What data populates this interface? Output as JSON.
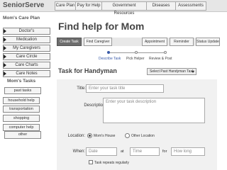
{
  "brand": "SeniorServe",
  "topnav": [
    "Care Plan",
    "Pay for Help",
    "Government Resources",
    "Diseases",
    "Assessments"
  ],
  "sidebar": {
    "plan_title": "Mom's Care Plan",
    "items": [
      "Doctor's",
      "Medication",
      "My Caregivers",
      "Care Circle",
      "Care Charts",
      "Care Notes"
    ],
    "tasks_title": "Mom's Tasks",
    "tasks": [
      "past tasks",
      "household help",
      "transportation",
      "shopping",
      "computer help",
      "other"
    ]
  },
  "page_title": "Find help for Mom",
  "toolbar": {
    "create_task": "Create Task",
    "find_caregiver": "Find Caregiver",
    "appointment": "Appointment",
    "reminder": "Reminder",
    "status_update": "Status Update"
  },
  "steps": [
    "Describe Task",
    "Pick Helper",
    "Review & Post"
  ],
  "task_title": "Task for Handyman",
  "select_past": "Select Past Handyman Task",
  "form": {
    "title_label": "Title:",
    "title_placeholder": "Enter your task title",
    "description_label": "Description:",
    "description_placeholder": "Enter your task description",
    "location_label": "Location:",
    "location_options": [
      "Mom's House",
      "Other Location"
    ],
    "when_label": "When:",
    "date_placeholder": "Date",
    "at_text": "at",
    "time_placeholder": "Time",
    "for_text": "for",
    "duration_placeholder": "How long",
    "repeat_label": "Task repeats regularly"
  }
}
